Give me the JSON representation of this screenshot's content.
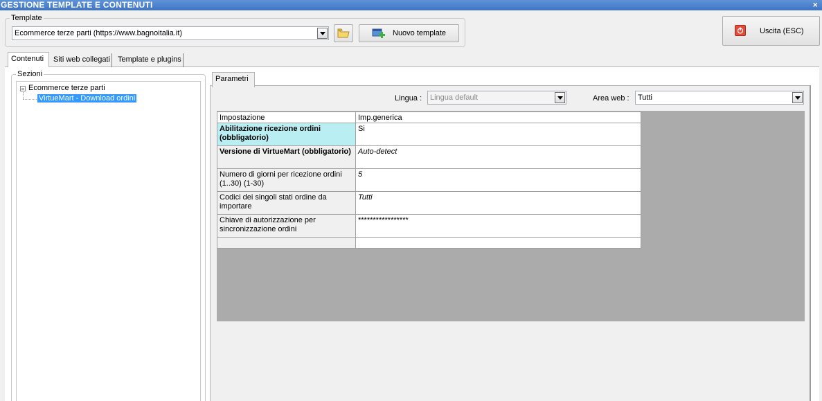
{
  "window": {
    "title": "GESTIONE TEMPLATE E CONTENUTI",
    "close_glyph": "×"
  },
  "template_group": {
    "legend": "Template",
    "selected": "Ecommerce terze parti (https://www.bagnoitalia.it)",
    "new_button_label": "Nuovo template"
  },
  "exit_button": {
    "label": "Uscita (ESC)"
  },
  "tabs": [
    {
      "label": "Contenuti",
      "active": true
    },
    {
      "label": "Siti web collegati",
      "active": false
    },
    {
      "label": "Template e plugins",
      "active": false
    }
  ],
  "sections": {
    "legend": "Sezioni",
    "root": "Ecommerce terze parti",
    "child": "VirtueMart - Download ordini"
  },
  "params_tab": {
    "label": "Parametri"
  },
  "filters": {
    "lingua_label": "Lingua :",
    "lingua_value": "Lingua default",
    "area_label": "Area web :",
    "area_value": "Tutti"
  },
  "grid": {
    "headers": [
      "Impostazione",
      "Imp.generica"
    ],
    "rows": [
      {
        "name": "Abilitazione ricezione ordini (obbligatorio)",
        "value": "Si"
      },
      {
        "name": "Versione di VirtueMart (obbligatorio)",
        "value": "Auto-detect"
      },
      {
        "name": "Numero di giorni per ricezione ordini (1..30) (1-30)",
        "value": "5"
      },
      {
        "name": "Codici dei singoli stati ordine da importare",
        "value": "Tutti"
      },
      {
        "name": "Chiave di autorizzazione per sincronizzazione ordini",
        "value": "*****************"
      },
      {
        "name": "",
        "value": ""
      }
    ]
  },
  "colors": {
    "title_bar": "#4a7fcc",
    "highlight_cell": "#b9eef2",
    "selection": "#3399ff",
    "grid_background": "#ababab"
  }
}
